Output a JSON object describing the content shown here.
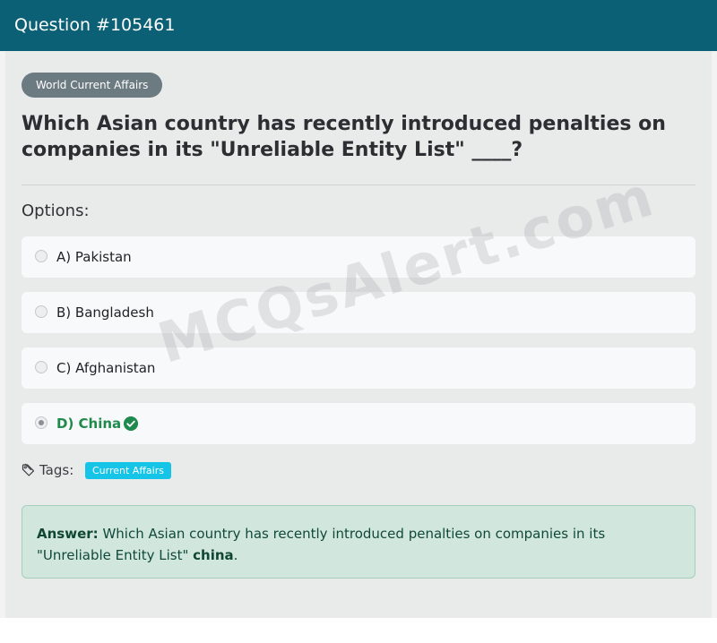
{
  "header": {
    "title": "Question #105461"
  },
  "category": {
    "label": "World Current Affairs"
  },
  "question": {
    "text": "Which Asian country has recently introduced penalties on companies in its \"Unreliable Entity List\" ____?"
  },
  "options_label": "Options:",
  "options": [
    {
      "label": "A) Pakistan",
      "selected": false,
      "correct": false
    },
    {
      "label": "B) Bangladesh",
      "selected": false,
      "correct": false
    },
    {
      "label": "C) Afghanistan",
      "selected": false,
      "correct": false
    },
    {
      "label": "D) China",
      "selected": true,
      "correct": true,
      "icon": "check-circle-icon"
    }
  ],
  "tags": {
    "label": "Tags:",
    "icon": "tag-icon",
    "items": [
      "Current Affairs"
    ]
  },
  "answer": {
    "prefix": "Answer:",
    "text": "Which Asian country has recently introduced penalties on companies in its \"Unreliable Entity List\"",
    "value": "china",
    "suffix": "."
  },
  "watermark": {
    "text": "MCQsAlert.com"
  },
  "colors": {
    "header_bg": "#0c6075",
    "correct": "#1f8a4c",
    "tag_chip": "#16c4e8",
    "answer_bg": "#d1e7dd",
    "category_pill": "#6c7a82"
  }
}
